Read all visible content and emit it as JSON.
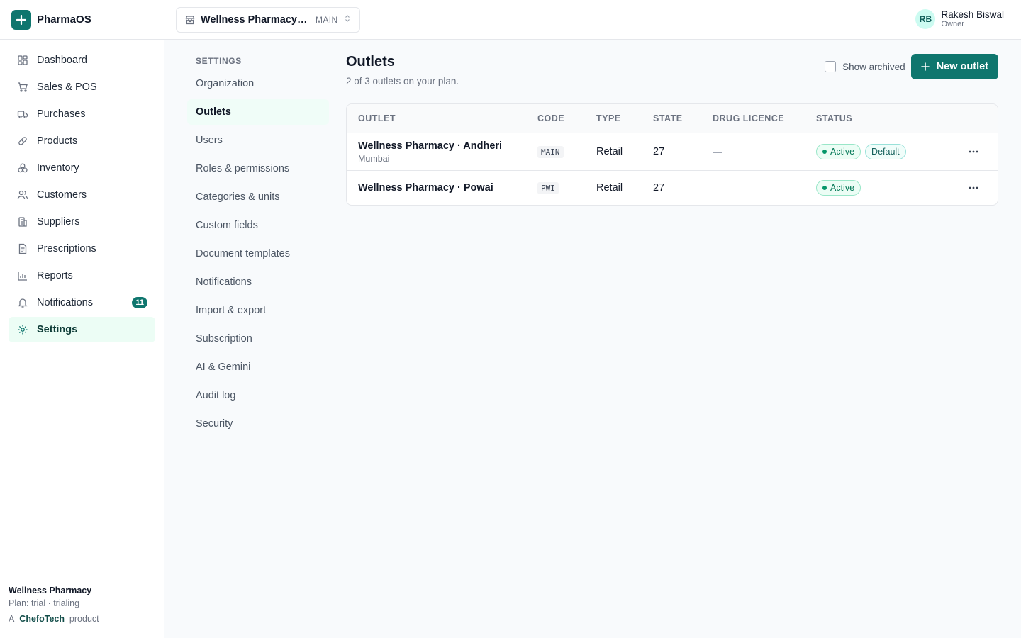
{
  "brand": {
    "name": "PharmaOS"
  },
  "sidebar": {
    "items": [
      {
        "label": "Dashboard",
        "icon": "dashboard-icon"
      },
      {
        "label": "Sales & POS",
        "icon": "cart-icon"
      },
      {
        "label": "Purchases",
        "icon": "truck-icon"
      },
      {
        "label": "Products",
        "icon": "pill-icon"
      },
      {
        "label": "Inventory",
        "icon": "boxes-icon"
      },
      {
        "label": "Customers",
        "icon": "users-icon"
      },
      {
        "label": "Suppliers",
        "icon": "building-icon"
      },
      {
        "label": "Prescriptions",
        "icon": "document-icon"
      },
      {
        "label": "Reports",
        "icon": "chart-icon"
      },
      {
        "label": "Notifications",
        "icon": "bell-icon",
        "badge": "11"
      },
      {
        "label": "Settings",
        "icon": "gear-icon",
        "active": true
      }
    ],
    "footer": {
      "org": "Wellness Pharmacy",
      "plan": "Plan: trial · trialing",
      "made_by_prefix": "A",
      "made_by_brand": "ChefoTech",
      "made_by_suffix": "product"
    }
  },
  "topbar": {
    "outlet_name": "Wellness Pharmacy · Andheri",
    "outlet_code": "MAIN",
    "user": {
      "initials": "RB",
      "name": "Rakesh Biswal",
      "role": "Owner"
    }
  },
  "settings_nav": {
    "title": "SETTINGS",
    "items": [
      "Organization",
      "Outlets",
      "Users",
      "Roles & permissions",
      "Categories & units",
      "Custom fields",
      "Document templates",
      "Notifications",
      "Import & export",
      "Subscription",
      "AI & Gemini",
      "Audit log",
      "Security"
    ],
    "active": "Outlets"
  },
  "main": {
    "title": "Outlets",
    "subtitle": "2 of 3 outlets on your plan.",
    "show_archived_label": "Show archived",
    "show_archived_checked": false,
    "new_outlet_label": "New outlet",
    "table": {
      "columns": [
        "OUTLET",
        "CODE",
        "TYPE",
        "STATE",
        "DRUG LICENCE",
        "STATUS"
      ],
      "rows": [
        {
          "name": "Wellness Pharmacy · Andheri",
          "city": "Mumbai",
          "code": "MAIN",
          "type": "Retail",
          "state": "27",
          "licence": "—",
          "status": "Active",
          "default_label": "Default"
        },
        {
          "name": "Wellness Pharmacy · Powai",
          "city": "",
          "code": "PWI",
          "type": "Retail",
          "state": "27",
          "licence": "—",
          "status": "Active"
        }
      ]
    }
  },
  "colors": {
    "accent": "#0f766e",
    "active_bg": "#ecfdf5",
    "status_green": "#059669"
  }
}
